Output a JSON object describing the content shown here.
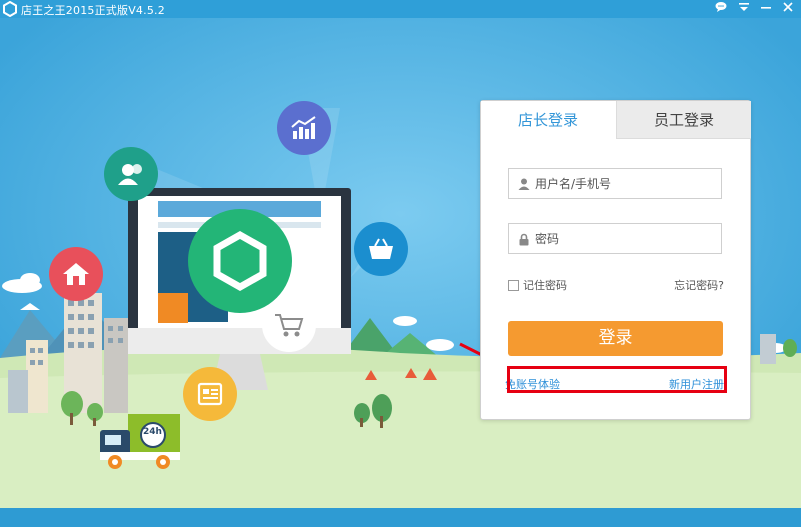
{
  "window": {
    "title": "店王之王2015正式版V4.5.2",
    "controls": {
      "chat_icon": "chat-bubble-icon",
      "menu_icon": "menu-icon",
      "minimize": "—",
      "close": "✕"
    }
  },
  "illustration": {
    "badge_24h": "24h",
    "icons": [
      "home-icon",
      "users-icon",
      "chart-up-icon",
      "basket-icon",
      "cart-icon",
      "news-icon",
      "store-logo-icon"
    ]
  },
  "login": {
    "tabs": [
      "店长登录",
      "员工登录"
    ],
    "username_placeholder": "用户名/手机号",
    "password_placeholder": "密码",
    "remember": "记住密码",
    "forgot": "忘记密码?",
    "submit": "登录",
    "demo_link": "免账号体验",
    "register_link": "新用户注册"
  },
  "colors": {
    "accent": "#3396d8",
    "login_button": "#f59a30",
    "highlight": "#e60012",
    "background": "#3ba4da"
  }
}
